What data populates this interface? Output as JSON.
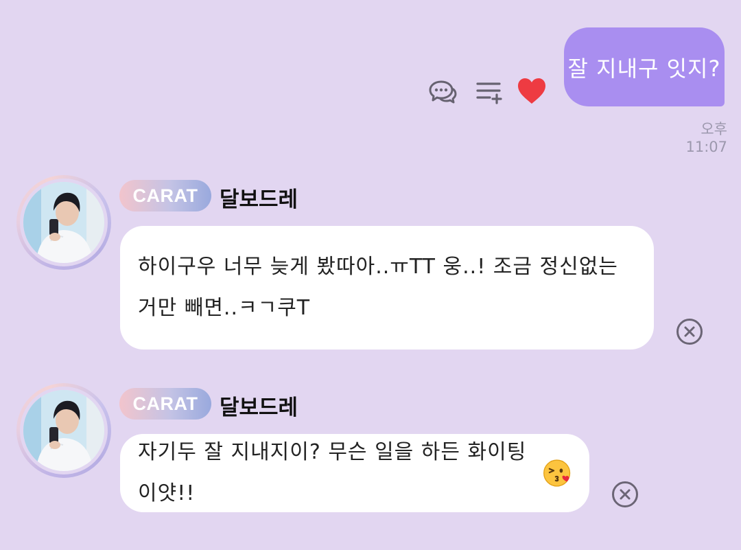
{
  "sent_message": {
    "text": "잘 지내구 잇지?",
    "time": "오후 11:07",
    "actions": [
      "comment-icon",
      "add-list-icon",
      "heart-icon"
    ],
    "bubble_color": "#a98ef0",
    "heart_color": "#ee3b42"
  },
  "received_messages": [
    {
      "badge": "CARAT",
      "sender": "달보드레",
      "text": "하이구우 너무 늦게 봤따아..ㅠTT 웅..! 조금 정신없는 거만 빼면..ㅋㄱ쿠T"
    },
    {
      "badge": "CARAT",
      "sender": "달보드레",
      "text": "자기두 잘 지내지이? 무슨 일을 하든 화이팅이얏!!",
      "emoji": "face-blowing-kiss"
    }
  ],
  "colors": {
    "background": "#e2d6f1",
    "received_bubble": "#ffffff"
  }
}
